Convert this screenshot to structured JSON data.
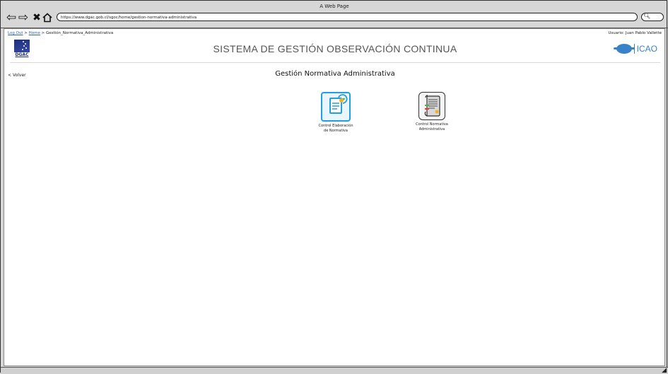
{
  "browser": {
    "window_title": "A Web Page",
    "url": "https://www.dgac.gob.cl/sgoc/home/gestion-normativa-administrativa"
  },
  "breadcrumb": {
    "logout": "Log Out",
    "home": "Home",
    "current": "Gestión_Normativa_Administrativa"
  },
  "user": {
    "label": "Usuario: Juan Pablo Vallette"
  },
  "header": {
    "dgac_text": "DGAC",
    "system_title": "SISTEMA DE GESTIÓN OBSERVACIÓN CONTINUA",
    "icao_text": "ICAO"
  },
  "page": {
    "back_label": "Volver",
    "title": "Gestión Normativa Administrativa"
  },
  "tiles": [
    {
      "line1": "Control Elaboración",
      "line2": "de Normativa",
      "icon": "document-refresh-icon",
      "selected": true
    },
    {
      "line1": "Control Normativa",
      "line2": "Administrativa",
      "icon": "scroll-list-icon",
      "selected": false
    }
  ],
  "colors": {
    "accent": "#1fa0e0",
    "link": "#2a62c6",
    "icao_blue": "#3a82c8",
    "dgac_navy": "#1d2f7a"
  }
}
